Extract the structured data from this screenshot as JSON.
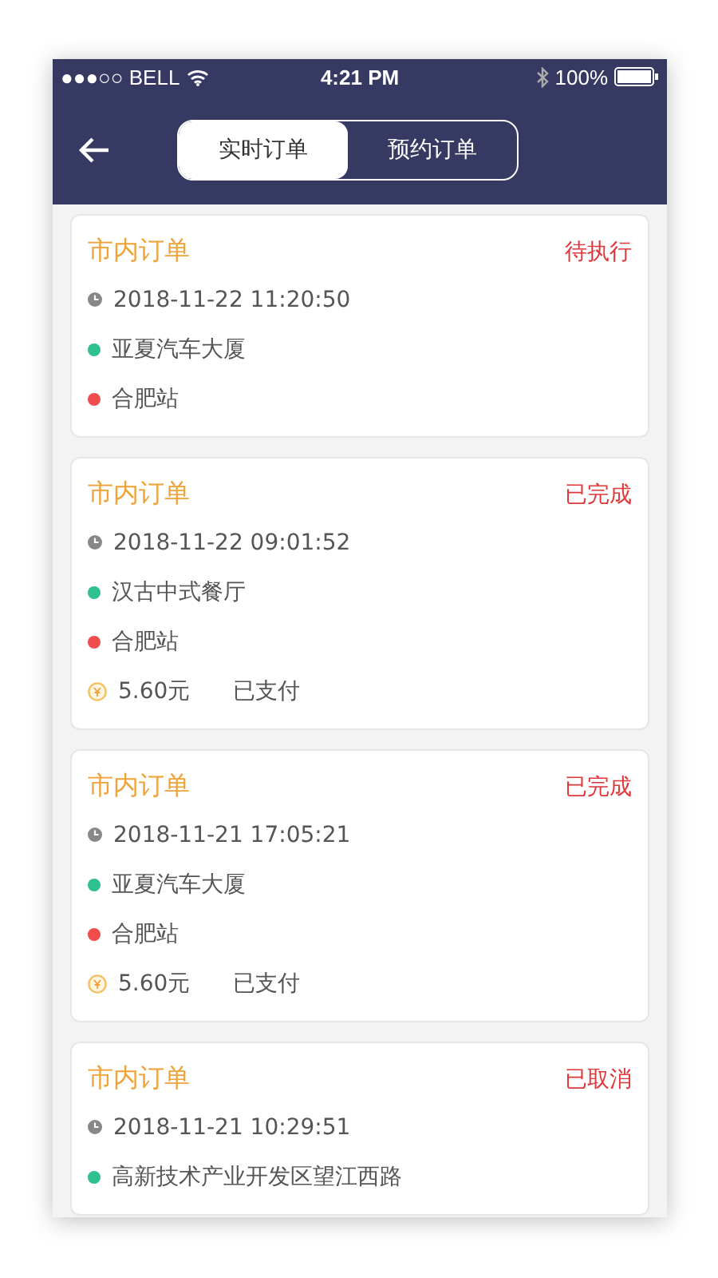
{
  "status_bar": {
    "carrier": "●●●○○ BELL",
    "time": "4:21 PM",
    "battery": "100%"
  },
  "header": {
    "tabs": [
      {
        "label": "实时订单",
        "selected": true
      },
      {
        "label": "预约订单",
        "selected": false
      }
    ]
  },
  "orders": [
    {
      "type": "市内订单",
      "status": "待执行",
      "time": "2018-11-22 11:20:50",
      "from": "亚夏汽车大厦",
      "to": "合肥站"
    },
    {
      "type": "市内订单",
      "status": "已完成",
      "time": "2018-11-22 09:01:52",
      "from": "汉古中式餐厅",
      "to": "合肥站",
      "fare": "5.60元",
      "payment": "已支付"
    },
    {
      "type": "市内订单",
      "status": "已完成",
      "time": "2018-11-21 17:05:21",
      "from": "亚夏汽车大厦",
      "to": "合肥站",
      "fare": "5.60元",
      "payment": "已支付"
    },
    {
      "type": "市内订单",
      "status": "已取消",
      "time": "2018-11-21 10:29:51",
      "from": "高新技术产业开发区望江西路"
    }
  ]
}
